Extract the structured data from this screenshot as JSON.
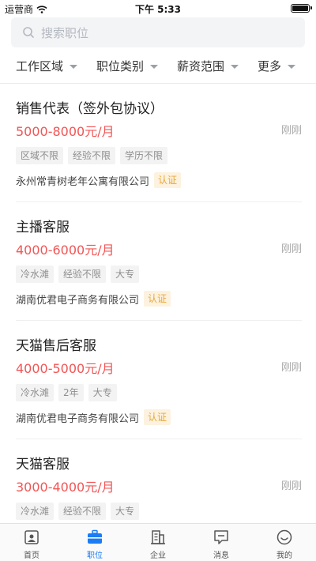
{
  "status_bar": {
    "carrier": "运营商",
    "time": "下午 5:33"
  },
  "search": {
    "placeholder": "搜索职位"
  },
  "filters": [
    {
      "label": "工作区域"
    },
    {
      "label": "职位类别"
    },
    {
      "label": "薪资范围"
    },
    {
      "label": "更多"
    }
  ],
  "jobs": [
    {
      "title": "销售代表（签外包协议）",
      "salary": "5000-8000元/月",
      "time": "刚刚",
      "tags": [
        "区域不限",
        "经验不限",
        "学历不限"
      ],
      "company": "永州常青树老年公寓有限公司",
      "verified": "认证"
    },
    {
      "title": "主播客服",
      "salary": "4000-6000元/月",
      "time": "刚刚",
      "tags": [
        "冷水滩",
        "经验不限",
        "大专"
      ],
      "company": "湖南优君电子商务有限公司",
      "verified": "认证"
    },
    {
      "title": "天猫售后客服",
      "salary": "4000-5000元/月",
      "time": "刚刚",
      "tags": [
        "冷水滩",
        "2年",
        "大专"
      ],
      "company": "湖南优君电子商务有限公司",
      "verified": "认证"
    },
    {
      "title": "天猫客服",
      "salary": "3000-4000元/月",
      "time": "刚刚",
      "tags": [
        "冷水滩",
        "经验不限",
        "大专"
      ],
      "company": "",
      "verified": ""
    }
  ],
  "tabbar": {
    "active_color": "#1c7cf4",
    "items": [
      {
        "label": "首页",
        "icon": "home-icon"
      },
      {
        "label": "职位",
        "icon": "briefcase-icon"
      },
      {
        "label": "企业",
        "icon": "building-icon"
      },
      {
        "label": "消息",
        "icon": "message-icon"
      },
      {
        "label": "我的",
        "icon": "profile-icon"
      }
    ]
  }
}
